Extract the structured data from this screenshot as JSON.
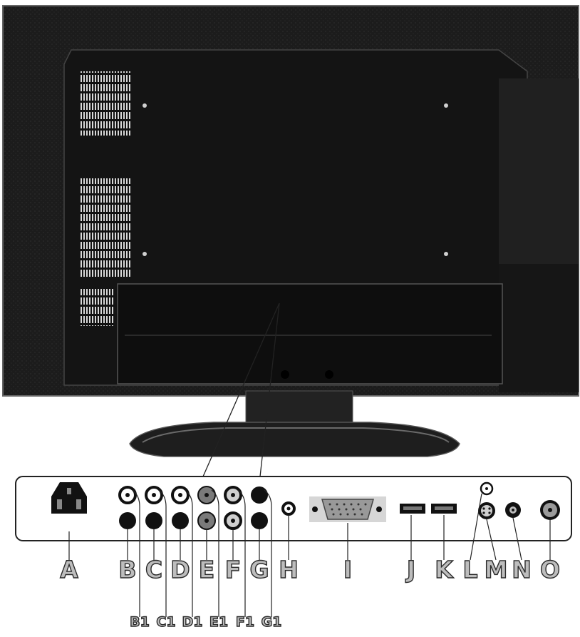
{
  "diagram": {
    "main_labels": [
      "A",
      "B",
      "C",
      "D",
      "E",
      "F",
      "G",
      "H",
      "I",
      "J",
      "K",
      "L",
      "M",
      "N",
      "O"
    ],
    "sub_labels": [
      "B1",
      "C1",
      "D1",
      "E1",
      "F1",
      "G1"
    ]
  }
}
